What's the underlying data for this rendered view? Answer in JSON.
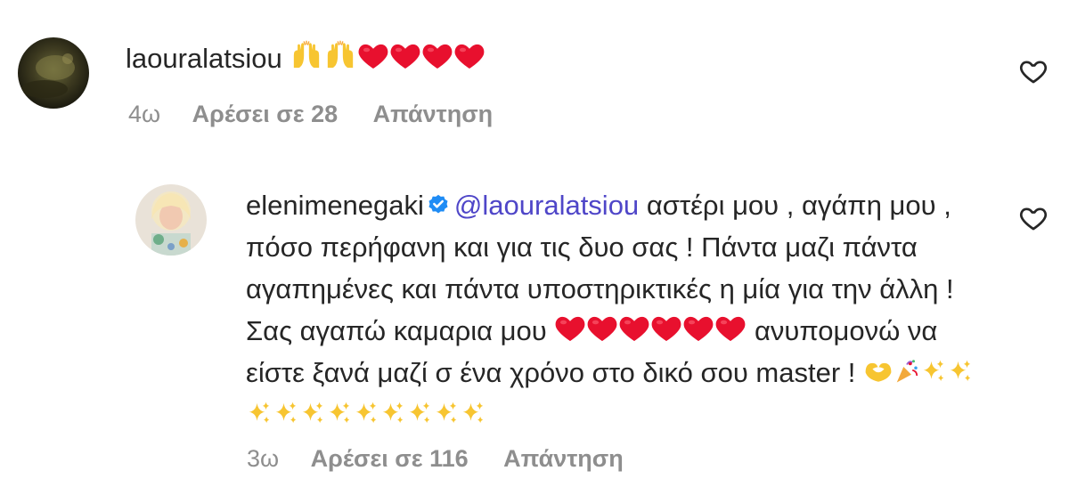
{
  "comments": [
    {
      "username": "laouralatsiou",
      "text": "",
      "emojis": [
        "raised-hands",
        "raised-hands",
        "red-heart",
        "red-heart",
        "red-heart",
        "red-heart"
      ],
      "time": "4ω",
      "likes_label": "Αρέσει σε 28",
      "reply_label": "Απάντηση"
    },
    {
      "username": "elenimenegaki",
      "verified": true,
      "mention": "@laouralatsiou",
      "text_part1": "αστέρι μου , αγάπη μου , πόσο περήφανη και για τις δυο σας ! Πάντα μαζι πάντα αγαπημένες και πάντα υποστηρικτικές η μία για την άλλη ! Σας αγαπώ καμαρια μου",
      "text_part2": "ανυπομονώ να είστε ξανά μαζί σ ένα χρόνο στο δικό σου master !",
      "emojis_1": [
        "red-heart",
        "red-heart",
        "red-heart",
        "red-heart",
        "red-heart",
        "red-heart"
      ],
      "emojis_2": [
        "heart-hands",
        "party-popper",
        "sparkles",
        "sparkles",
        "sparkles",
        "sparkles",
        "sparkles",
        "sparkles",
        "sparkles",
        "sparkles",
        "sparkles",
        "sparkles",
        "sparkles"
      ],
      "time": "3ω",
      "likes_label": "Αρέσει σε 116",
      "reply_label": "Απάντηση"
    }
  ],
  "colors": {
    "text": "#262626",
    "meta": "#8e8e8e",
    "mention": "#4f46c8",
    "verified": "#1f8cf5",
    "heart": "#e8102e"
  },
  "icons": {
    "like": "heart-outline-icon",
    "verified": "verified-badge-icon"
  }
}
